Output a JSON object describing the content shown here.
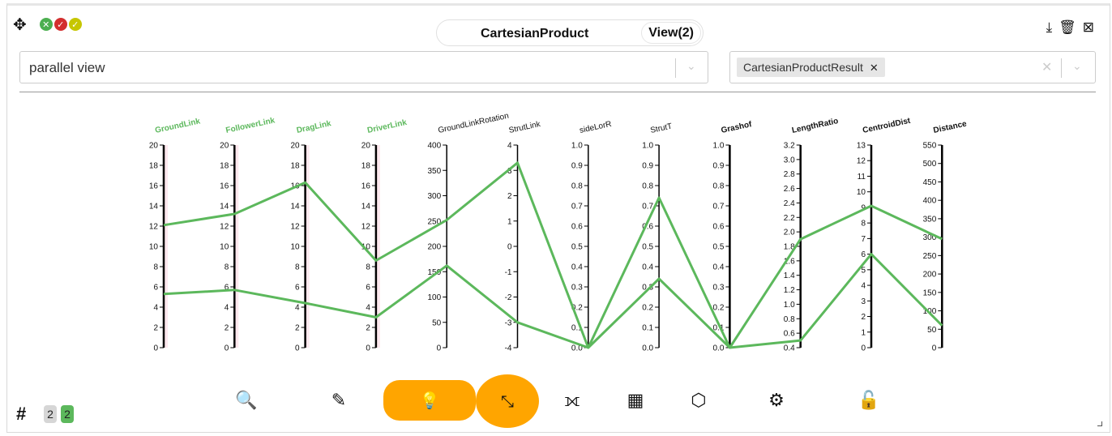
{
  "window": {
    "title": "CartesianProduct",
    "view_button": "View(2)",
    "status_dots": [
      {
        "name": "close-status-icon",
        "color": "#4caf50",
        "glyph": "✕"
      },
      {
        "name": "error-status-icon",
        "color": "#d32f2f",
        "glyph": "✓"
      },
      {
        "name": "ok-status-icon",
        "color": "#c6c600",
        "glyph": "✓"
      }
    ],
    "right_icons": [
      "download-icon",
      "trash-icon",
      "delete-box-icon"
    ]
  },
  "view_select": {
    "value": "parallel view"
  },
  "result_select": {
    "tag": "CartesianProductResult"
  },
  "chart_data": {
    "type": "parallel_coordinates",
    "axes": [
      {
        "name": "GroundLink",
        "highlighted": true,
        "bold": true,
        "range": [
          0,
          20
        ],
        "ticks": [
          0,
          2,
          4,
          6,
          8,
          10,
          12,
          14,
          16,
          18,
          20
        ],
        "tick_labels": [
          "0",
          "2",
          "4",
          "6",
          "8",
          "10",
          "12",
          "14",
          "16",
          "18",
          "20"
        ],
        "pink": true
      },
      {
        "name": "FollowerLink",
        "highlighted": true,
        "bold": true,
        "range": [
          0,
          20
        ],
        "ticks": [
          0,
          2,
          4,
          6,
          8,
          10,
          12,
          14,
          16,
          18,
          20
        ],
        "tick_labels": [
          "0",
          "2",
          "4",
          "6",
          "8",
          "10",
          "12",
          "14",
          "16",
          "18",
          "20"
        ],
        "pink": true
      },
      {
        "name": "DragLink",
        "highlighted": true,
        "bold": true,
        "range": [
          0,
          20
        ],
        "ticks": [
          0,
          2,
          4,
          6,
          8,
          10,
          12,
          14,
          16,
          18,
          20
        ],
        "tick_labels": [
          "0",
          "2",
          "4",
          "6",
          "8",
          "10",
          "12",
          "14",
          "16",
          "18",
          "20"
        ],
        "pink": true
      },
      {
        "name": "DriverLink",
        "highlighted": true,
        "bold": true,
        "range": [
          0,
          20
        ],
        "ticks": [
          0,
          2,
          4,
          6,
          8,
          10,
          12,
          14,
          16,
          18,
          20
        ],
        "tick_labels": [
          "0",
          "2",
          "4",
          "6",
          "8",
          "10",
          "12",
          "14",
          "16",
          "18",
          "20"
        ],
        "pink": true
      },
      {
        "name": "GroundLinkRotation",
        "highlighted": false,
        "bold": false,
        "range": [
          0,
          400
        ],
        "ticks": [
          0,
          50,
          100,
          150,
          200,
          250,
          300,
          350,
          400
        ],
        "tick_labels": [
          "0",
          "50",
          "100",
          "150",
          "200",
          "250",
          "300",
          "350",
          "400"
        ],
        "pink": false
      },
      {
        "name": "StrutLink",
        "highlighted": false,
        "bold": false,
        "range": [
          -4,
          4
        ],
        "ticks": [
          -4,
          -3,
          -2,
          -1,
          0,
          1,
          2,
          3,
          4
        ],
        "tick_labels": [
          "-4",
          "-3",
          "-2",
          "-1",
          "0",
          "1",
          "2",
          "3",
          "4"
        ],
        "pink": false
      },
      {
        "name": "sideLorR",
        "highlighted": false,
        "bold": false,
        "range": [
          0,
          1
        ],
        "ticks": [
          0,
          0.1,
          0.2,
          0.3,
          0.4,
          0.5,
          0.6,
          0.7,
          0.8,
          0.9,
          1
        ],
        "tick_labels": [
          "0.0",
          "0.1",
          "0.2",
          "0.3",
          "0.4",
          "0.5",
          "0.6",
          "0.7",
          "0.8",
          "0.9",
          "1.0"
        ],
        "pink": false
      },
      {
        "name": "StrutT",
        "highlighted": false,
        "bold": false,
        "range": [
          0,
          1
        ],
        "ticks": [
          0,
          0.1,
          0.2,
          0.3,
          0.4,
          0.5,
          0.6,
          0.7,
          0.8,
          0.9,
          1
        ],
        "tick_labels": [
          "0.0",
          "0.1",
          "0.2",
          "0.3",
          "0.4",
          "0.5",
          "0.6",
          "0.7",
          "0.8",
          "0.9",
          "1.0"
        ],
        "pink": false
      },
      {
        "name": "Grashof",
        "highlighted": false,
        "bold": true,
        "range": [
          0,
          1
        ],
        "ticks": [
          0,
          0.1,
          0.2,
          0.3,
          0.4,
          0.5,
          0.6,
          0.7,
          0.8,
          0.9,
          1
        ],
        "tick_labels": [
          "0.0",
          "0.1",
          "0.2",
          "0.3",
          "0.4",
          "0.5",
          "0.6",
          "0.7",
          "0.8",
          "0.9",
          "1.0"
        ],
        "pink": false
      },
      {
        "name": "LengthRatio",
        "highlighted": false,
        "bold": true,
        "range": [
          0.4,
          3.2
        ],
        "ticks": [
          0.4,
          0.6,
          0.8,
          1.0,
          1.2,
          1.4,
          1.6,
          1.8,
          2.0,
          2.2,
          2.4,
          2.6,
          2.8,
          3.0,
          3.2
        ],
        "tick_labels": [
          "0.4",
          "0.6",
          "0.8",
          "1.0",
          "1.2",
          "1.4",
          "1.6",
          "1.8",
          "2.0",
          "2.2",
          "2.4",
          "2.6",
          "2.8",
          "3.0",
          "3.2"
        ],
        "pink": false
      },
      {
        "name": "CentroidDist",
        "highlighted": false,
        "bold": true,
        "range": [
          0,
          13
        ],
        "ticks": [
          0,
          1,
          2,
          3,
          4,
          5,
          6,
          7,
          8,
          9,
          10,
          11,
          12,
          13
        ],
        "tick_labels": [
          "0",
          "1",
          "2",
          "3",
          "4",
          "5",
          "6",
          "7",
          "8",
          "9",
          "10",
          "11",
          "12",
          "13"
        ],
        "pink": false
      },
      {
        "name": "Distance",
        "highlighted": false,
        "bold": true,
        "range": [
          0,
          550
        ],
        "ticks": [
          0,
          50,
          100,
          150,
          200,
          250,
          300,
          350,
          400,
          450,
          500,
          550
        ],
        "tick_labels": [
          "0",
          "50",
          "100",
          "150",
          "200",
          "250",
          "300",
          "350",
          "400",
          "450",
          "500",
          "550"
        ],
        "pink": false
      }
    ],
    "series": [
      {
        "values": [
          12.1,
          13.2,
          16.3,
          8.6,
          252,
          3.3,
          0.0,
          0.74,
          0.0,
          1.9,
          9.1,
          295
        ]
      },
      {
        "values": [
          5.3,
          5.7,
          4.4,
          3.0,
          162,
          -3.0,
          0.0,
          0.34,
          0.0,
          0.5,
          6.0,
          60
        ]
      }
    ],
    "line_color": "#5cb85c"
  },
  "toolbar": [
    {
      "name": "search-icon",
      "glyph": "🔍",
      "style": "plain"
    },
    {
      "name": "pencil-icon",
      "glyph": "✎",
      "style": "plain"
    },
    {
      "name": "lightbulb-icon",
      "glyph": "💡",
      "style": "pill"
    },
    {
      "name": "shrink-arrows-icon",
      "glyph": "⤡",
      "style": "circle"
    },
    {
      "name": "axis-swap-icon",
      "glyph": "⟗",
      "style": "plain"
    },
    {
      "name": "grid-filter-icon",
      "glyph": "▦",
      "style": "plain"
    },
    {
      "name": "network-icon",
      "glyph": "⬡",
      "style": "plain"
    },
    {
      "name": "settings-gear-icon",
      "glyph": "⚙",
      "style": "plain"
    },
    {
      "name": "unlock-icon",
      "glyph": "🔓",
      "style": "plain"
    }
  ],
  "footer": {
    "hash": "#",
    "badge_left": "2",
    "badge_right": "2",
    "badge_left_color": "#d6d6d6",
    "badge_right_color": "#5cb85c"
  }
}
